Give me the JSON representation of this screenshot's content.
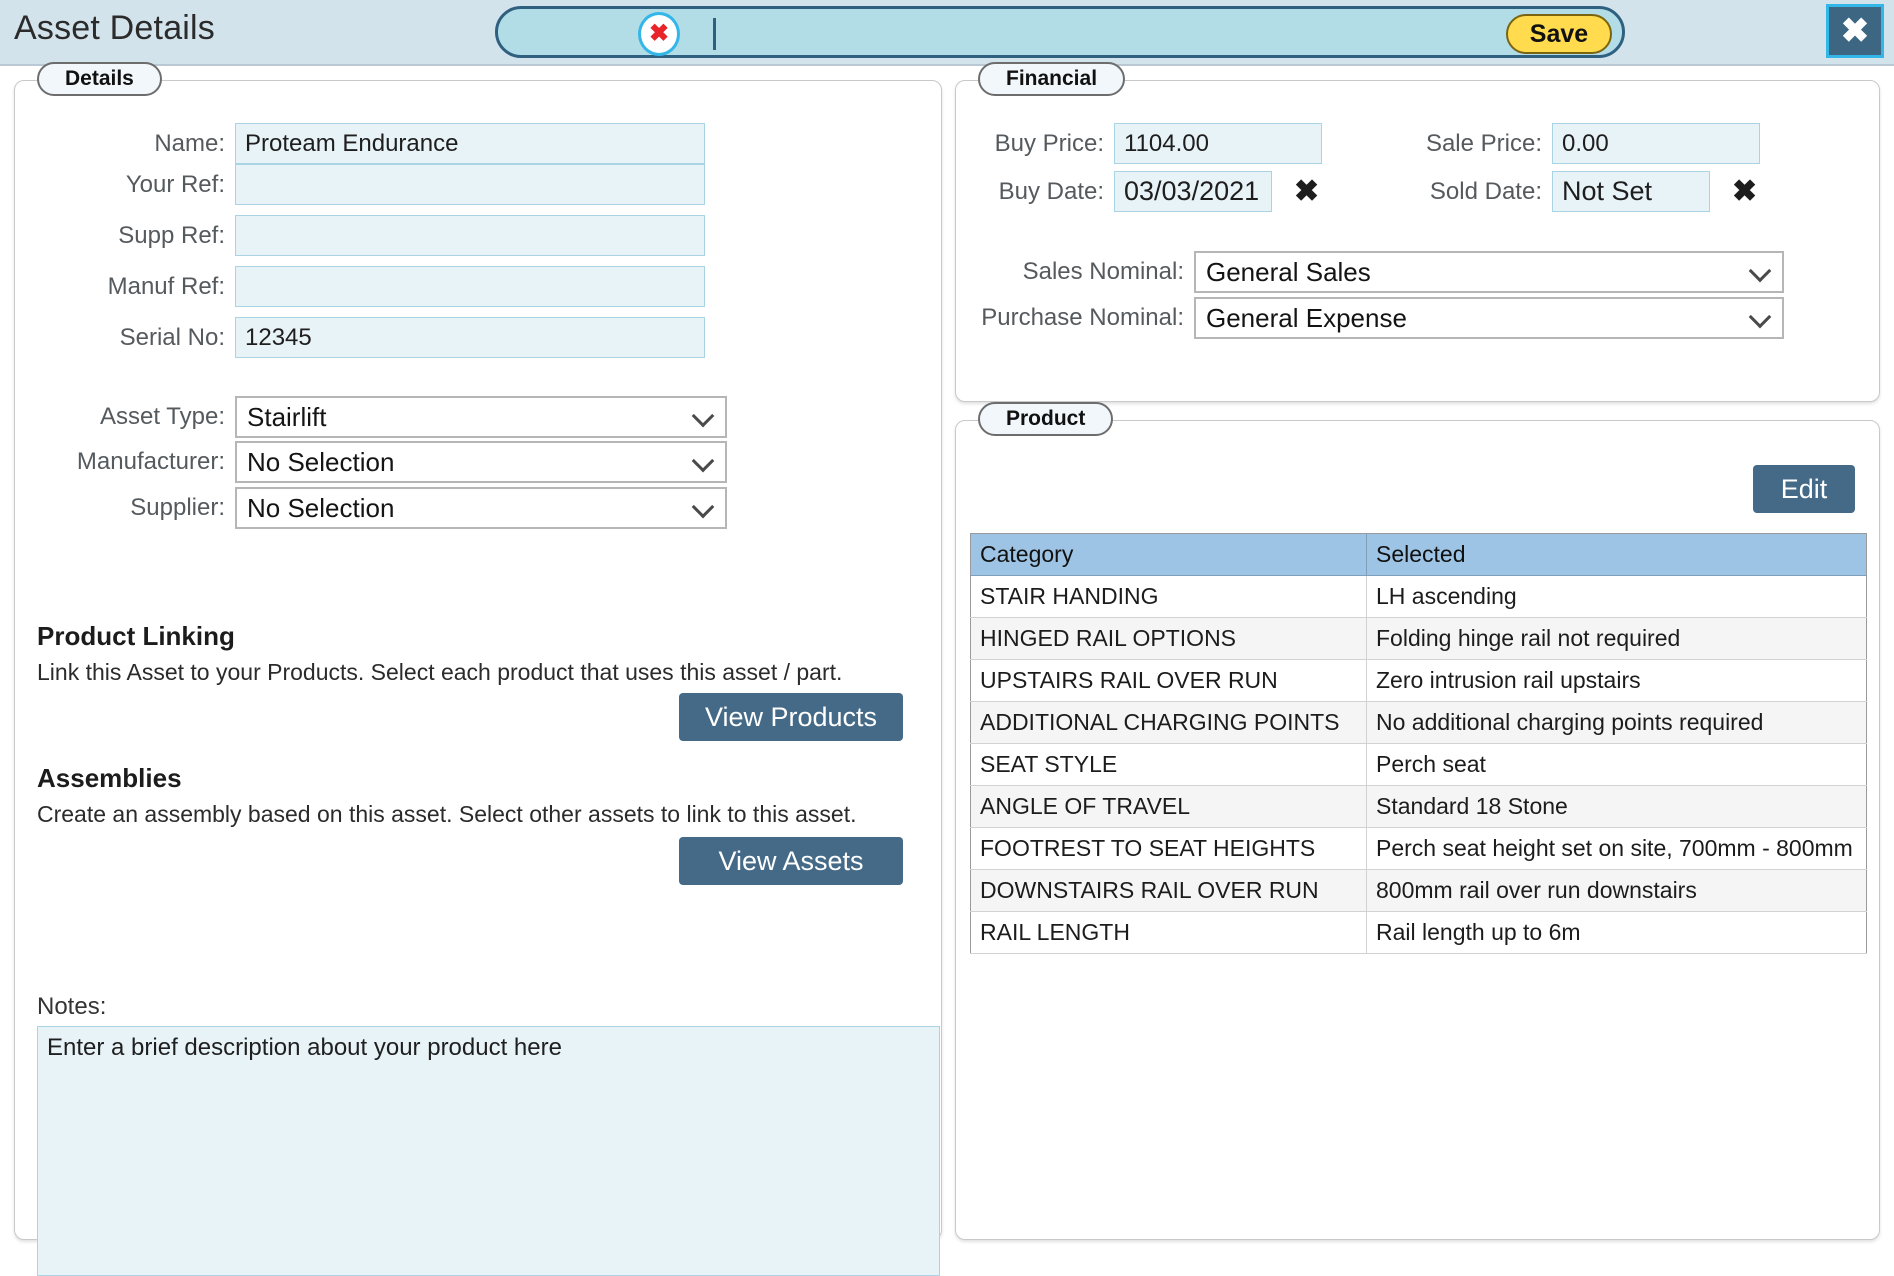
{
  "titlebar": {
    "title": "Asset Details",
    "clear_icon": "red-x-circle-icon",
    "save_label": "Save",
    "close_icon": "close-x-icon"
  },
  "details": {
    "legend": "Details",
    "fields": [
      {
        "label": "Name:",
        "value": "Proteam Endurance"
      },
      {
        "label": "Your Ref:",
        "value": ""
      },
      {
        "label": "Supp Ref:",
        "value": ""
      },
      {
        "label": "Manuf Ref:",
        "value": ""
      },
      {
        "label": "Serial No:",
        "value": "12345"
      }
    ],
    "selects": [
      {
        "label": "Asset Type:",
        "value": "Stairlift"
      },
      {
        "label": "Manufacturer:",
        "value": "No Selection"
      },
      {
        "label": "Supplier:",
        "value": "No Selection"
      }
    ],
    "product_linking": {
      "heading": "Product Linking",
      "description": "Link this Asset to your Products. Select each product that uses this asset / part.",
      "button": "View Products"
    },
    "assemblies": {
      "heading": "Assemblies",
      "description": "Create an assembly based on this asset. Select other assets to link to this asset.",
      "button": "View Assets"
    },
    "notes": {
      "label": "Notes:",
      "value": "Enter a brief description about your product here"
    }
  },
  "financial": {
    "legend": "Financial",
    "buy_price_label": "Buy Price:",
    "buy_price_value": "1104.00",
    "sale_price_label": "Sale Price:",
    "sale_price_value": "0.00",
    "buy_date_label": "Buy Date:",
    "buy_date_value": "03/03/2021",
    "sold_date_label": "Sold Date:",
    "sold_date_value": "Not Set",
    "sales_nominal_label": "Sales Nominal:",
    "sales_nominal_value": "General Sales",
    "purchase_nominal_label": "Purchase Nominal:",
    "purchase_nominal_value": "General Expense",
    "clear_icon": "x-icon"
  },
  "product": {
    "legend": "Product",
    "edit_label": "Edit",
    "columns": [
      "Category",
      "Selected"
    ],
    "rows": [
      {
        "category": "STAIR HANDING",
        "selected": "LH ascending"
      },
      {
        "category": "HINGED RAIL OPTIONS",
        "selected": "Folding hinge rail not required"
      },
      {
        "category": "UPSTAIRS RAIL OVER RUN",
        "selected": "Zero intrusion rail upstairs"
      },
      {
        "category": "ADDITIONAL CHARGING POINTS",
        "selected": "No additional charging points required"
      },
      {
        "category": "SEAT STYLE",
        "selected": "Perch seat"
      },
      {
        "category": "ANGLE OF TRAVEL",
        "selected": "Standard 18 Stone"
      },
      {
        "category": "FOOTREST TO SEAT HEIGHTS",
        "selected": "Perch seat height set on site, 700mm - 800mm"
      },
      {
        "category": "DOWNSTAIRS RAIL OVER RUN",
        "selected": "800mm rail over run downstairs"
      },
      {
        "category": "RAIL LENGTH",
        "selected": "Rail length up to 6m"
      }
    ]
  },
  "colors": {
    "titlebar_bg": "#d3e3ec",
    "pill_bg": "#b2dce6",
    "save_yellow": "#ffdb4d",
    "dark_blue": "#446a87",
    "field_blue": "#e8f3f8",
    "table_header": "#9dc4e4"
  }
}
